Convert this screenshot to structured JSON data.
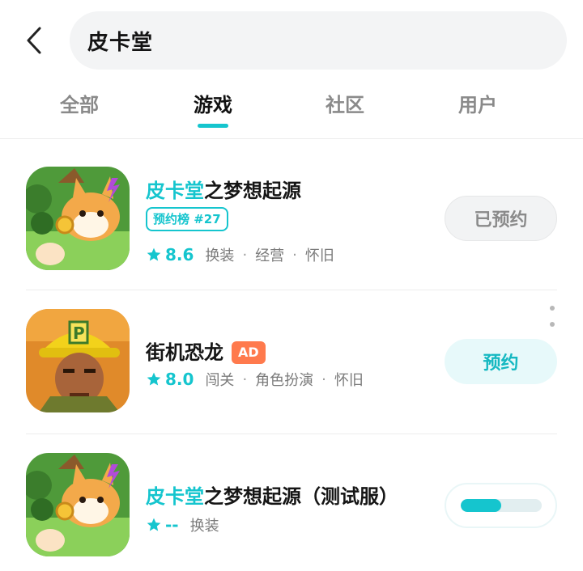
{
  "search": {
    "query": "皮卡堂"
  },
  "tabs": [
    {
      "label": "全部"
    },
    {
      "label": "游戏"
    },
    {
      "label": "社区"
    },
    {
      "label": "用户"
    }
  ],
  "active_tab": "游戏",
  "colors": {
    "accent": "#15c5ce",
    "ad": "#ff7a4d",
    "text": "#151515",
    "muted": "#7b7b7b"
  },
  "results": [
    {
      "name_highlight": "皮卡堂",
      "name_rest": "之梦想起源",
      "rank_badge": "预约榜 #27",
      "score": "8.6",
      "tags": [
        "换装",
        "经营",
        "怀旧"
      ],
      "separator": "·",
      "button_label": "已预约",
      "icon": "pikatang-corgi-icon"
    },
    {
      "name": "街机恐龙",
      "ad_label": "AD",
      "score": "8.0",
      "tags": [
        "闯关",
        "角色扮演",
        "怀旧"
      ],
      "separator": "·",
      "button_label": "预约",
      "icon": "arcade-dino-soldier-icon"
    },
    {
      "name_highlight": "皮卡堂",
      "name_rest": "之梦想起源（测试服）",
      "score": "--",
      "tags": [
        "换装"
      ],
      "download_progress": 0.5,
      "icon": "pikatang-corgi-icon"
    }
  ]
}
